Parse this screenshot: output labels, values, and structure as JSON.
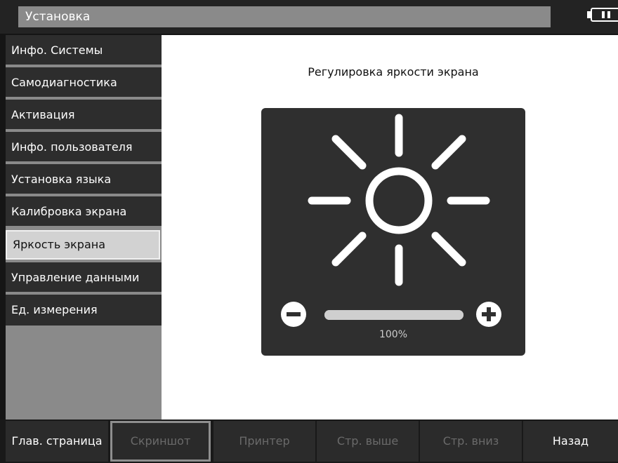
{
  "header": {
    "title": "Установка",
    "battery_icon": "battery-icon"
  },
  "sidebar": {
    "items": [
      {
        "label": "Инфо. Системы"
      },
      {
        "label": "Самодиагностика"
      },
      {
        "label": "Активация"
      },
      {
        "label": "Инфо. пользователя"
      },
      {
        "label": "Установка языка"
      },
      {
        "label": "Калибровка экрана"
      },
      {
        "label": "Яркость экрана",
        "active": true
      },
      {
        "label": "Управление данными"
      },
      {
        "label": "Ед. измерения"
      }
    ]
  },
  "main": {
    "heading": "Регулировка яркости экрана",
    "brightness": {
      "value_label": "100%",
      "level": 1.0,
      "icon": "sun-icon"
    }
  },
  "bottom": {
    "buttons": [
      {
        "label": "Глав. страница",
        "state": "enabled"
      },
      {
        "label": "Скриншот",
        "state": "selected-disabled"
      },
      {
        "label": "Принтер",
        "state": "disabled"
      },
      {
        "label": "Стр. выше",
        "state": "disabled"
      },
      {
        "label": "Стр. вниз",
        "state": "disabled"
      },
      {
        "label": "Назад",
        "state": "enabled"
      }
    ]
  },
  "colors": {
    "panel": "#2f2f2f",
    "sidebar_bg": "#8a8a8a",
    "active_item": "#d2d2d2"
  }
}
